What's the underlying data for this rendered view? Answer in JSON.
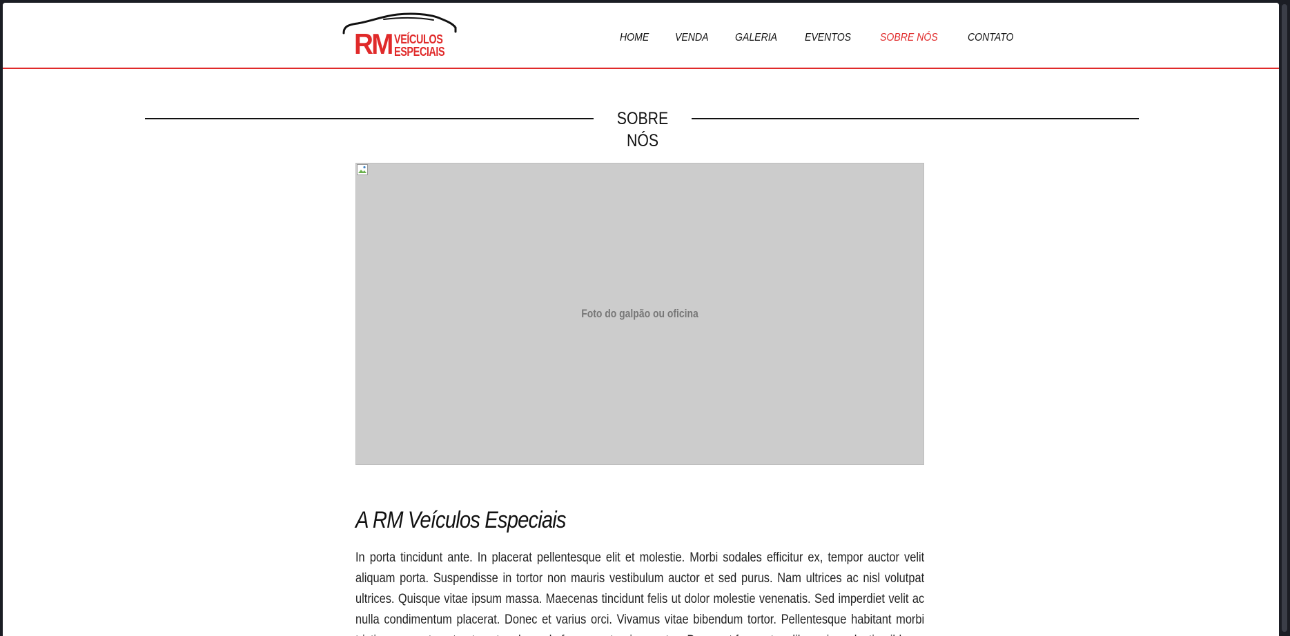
{
  "logo": {
    "rm": "RM",
    "line1": "VEÍCULOS",
    "line2": "ESPECIAIS",
    "icon": "car-silhouette-icon"
  },
  "nav": {
    "items": [
      {
        "label": "HOME"
      },
      {
        "label": "VENDA"
      },
      {
        "label": "GALERIA"
      },
      {
        "label": "EVENTOS"
      },
      {
        "label": "SOBRE NÓS"
      },
      {
        "label": "CONTATO"
      }
    ],
    "active": "SOBRE NÓS"
  },
  "section": {
    "title": "SOBRE NÓS"
  },
  "photo": {
    "caption": "Foto do galpão ou oficina",
    "icon": "broken-image-icon"
  },
  "about": {
    "heading": "A RM Veículos Especiais",
    "paragraph": "In porta tincidunt ante. In placerat pellentesque elit et molestie. Morbi sodales efficitur ex, tempor auctor velit aliquam porta. Suspendisse in tortor non mauris vestibulum auctor et sed purus. Nam ultrices ac nisl volutpat ultrices. Quisque vitae ipsum massa. Maecenas tincidunt felis ut dolor molestie venenatis. Sed imperdiet velit ac nulla condimentum placerat. Donec et varius orci. Vivamus vitae bibendum tortor. Pellentesque habitant morbi tristique senectus et netus et malesuada fames ac turpis egestas. Donec at fermentum libero, in molestie nibh."
  },
  "colors": {
    "accent": "#e02a2a",
    "text": "#111111",
    "placeholder_bg": "#cccccc",
    "frame": "#1b1d24"
  }
}
